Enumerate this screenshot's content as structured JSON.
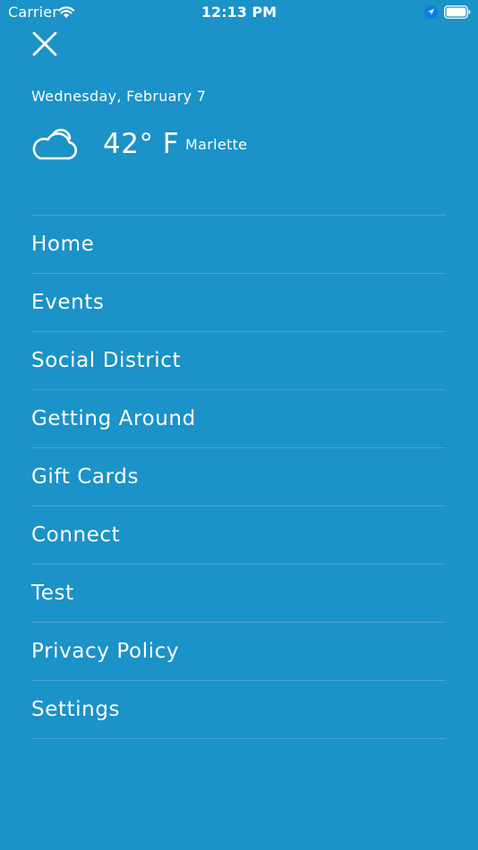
{
  "status_bar": {
    "carrier": "Carrier",
    "time": "12:13 PM"
  },
  "weather": {
    "date": "Wednesday, February 7",
    "temperature": "42° F",
    "location": "Marlette",
    "icon": "cloud-icon"
  },
  "menu": {
    "items": [
      {
        "label": "Home"
      },
      {
        "label": "Events"
      },
      {
        "label": "Social District"
      },
      {
        "label": "Getting Around"
      },
      {
        "label": "Gift Cards"
      },
      {
        "label": "Connect"
      },
      {
        "label": "Test"
      },
      {
        "label": "Privacy Policy"
      },
      {
        "label": "Settings"
      }
    ]
  },
  "colors": {
    "background": "#1b92c8",
    "foreground": "#ffffff"
  }
}
